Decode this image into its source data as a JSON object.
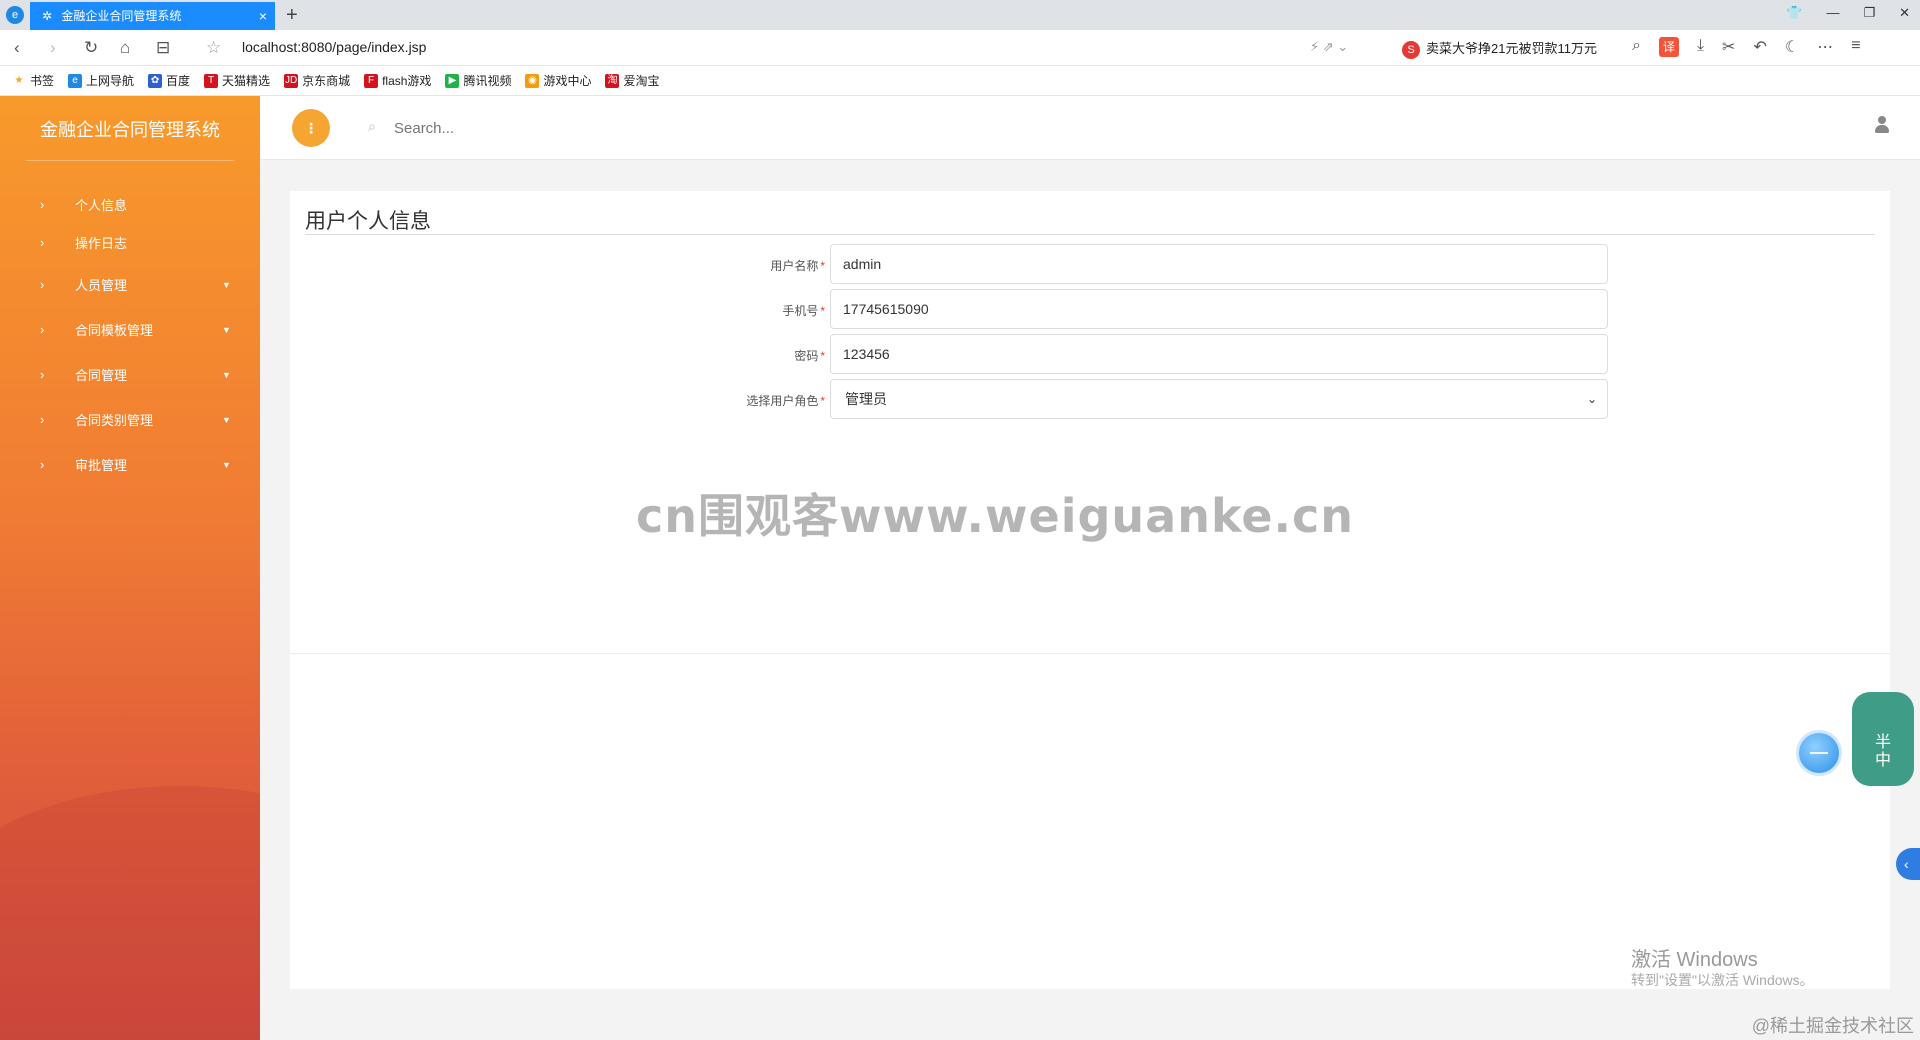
{
  "browser": {
    "tab_title": "金融企业合同管理系统",
    "tab_close": "×",
    "new_tab": "+",
    "url": "localhost:8080/page/index.jsp",
    "news_text": "卖菜大爷挣21元被罚款11万元",
    "news_badge": "S",
    "translate_label": "译",
    "bookmarks": [
      {
        "label": "书签",
        "icon": "star-icon",
        "color": "#f5a623"
      },
      {
        "label": "上网导航",
        "icon": "ie-icon",
        "color": "#1e88e5"
      },
      {
        "label": "百度",
        "icon": "baidu-icon",
        "color": "#2f5fd1"
      },
      {
        "label": "天猫精选",
        "icon": "tmall-icon",
        "color": "#d3131e"
      },
      {
        "label": "京东商城",
        "icon": "jd-icon",
        "color": "#d3131e"
      },
      {
        "label": "flash游戏",
        "icon": "flash-icon",
        "color": "#d3131e"
      },
      {
        "label": "腾讯视频",
        "icon": "tencent-video-icon",
        "color": "#20b34a"
      },
      {
        "label": "游戏中心",
        "icon": "game-icon",
        "color": "#f39c12"
      },
      {
        "label": "爱淘宝",
        "icon": "taobao-icon",
        "color": "#d3131e"
      }
    ]
  },
  "sidebar": {
    "brand": "金融企业合同管理系统",
    "items": [
      {
        "label": "个人信息",
        "has_submenu": false
      },
      {
        "label": "操作日志",
        "has_submenu": false
      },
      {
        "label": "人员管理",
        "has_submenu": true
      },
      {
        "label": "合同模板管理",
        "has_submenu": true
      },
      {
        "label": "合同管理",
        "has_submenu": true
      },
      {
        "label": "合同类别管理",
        "has_submenu": true
      },
      {
        "label": "审批管理",
        "has_submenu": true
      }
    ]
  },
  "topbar": {
    "search_placeholder": "Search..."
  },
  "page": {
    "title": "用户个人信息",
    "form": {
      "username": {
        "label": "用户名称",
        "value": "admin"
      },
      "phone": {
        "label": "手机号",
        "value": "17745615090"
      },
      "password": {
        "label": "密码",
        "value": "123456"
      },
      "role": {
        "label": "选择用户角色",
        "value": "管理员"
      }
    },
    "required_mark": "*"
  },
  "overlays": {
    "watermark": "cn围观客www.weiguanke.cn",
    "windows_activation_title": "激活 Windows",
    "windows_activation_sub": "转到\"设置\"以激活 Windows。",
    "juejin_credit": "@稀土掘金技术社区",
    "widget_text": "半\n中"
  },
  "colors": {
    "sidebar_top": "#f89a2b",
    "sidebar_bottom": "#cf4a3f",
    "accent": "#f7a532",
    "tab_active": "#1a8cff",
    "required": "#e53935"
  }
}
